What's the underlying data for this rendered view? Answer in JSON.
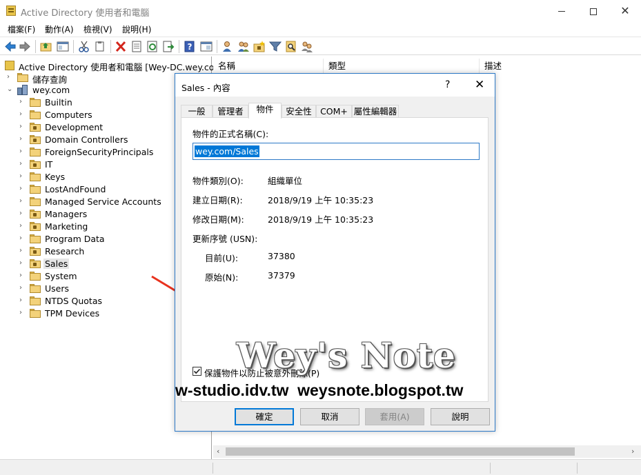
{
  "window": {
    "title": "Active Directory 使用者和電腦"
  },
  "menu": [
    "檔案(F)",
    "動作(A)",
    "檢視(V)",
    "說明(H)"
  ],
  "toolbar_icons": [
    "back-icon",
    "forward-icon",
    "up-folder-icon",
    "show-hide-tree-icon",
    "cut-icon",
    "copy-icon",
    "delete-icon",
    "properties-icon",
    "refresh-icon",
    "export-icon",
    "help-icon",
    "console-icon",
    "new-user-icon",
    "new-group-icon",
    "new-ou-icon",
    "filter-icon",
    "find-icon",
    "add-to-group-icon"
  ],
  "tree": {
    "root_label": "Active Directory 使用者和電腦 [Wey-DC.wey.com]",
    "saved_queries": "儲存查詢",
    "domain": "wey.com",
    "items": [
      {
        "label": "Builtin",
        "type": "container"
      },
      {
        "label": "Computers",
        "type": "container"
      },
      {
        "label": "Development",
        "type": "ou"
      },
      {
        "label": "Domain Controllers",
        "type": "ou"
      },
      {
        "label": "ForeignSecurityPrincipals",
        "type": "container"
      },
      {
        "label": "IT",
        "type": "ou"
      },
      {
        "label": "Keys",
        "type": "container"
      },
      {
        "label": "LostAndFound",
        "type": "container"
      },
      {
        "label": "Managed Service Accounts",
        "type": "container"
      },
      {
        "label": "Managers",
        "type": "ou"
      },
      {
        "label": "Marketing",
        "type": "ou"
      },
      {
        "label": "Program Data",
        "type": "container"
      },
      {
        "label": "Research",
        "type": "ou"
      },
      {
        "label": "Sales",
        "type": "ou"
      },
      {
        "label": "System",
        "type": "container"
      },
      {
        "label": "Users",
        "type": "container"
      },
      {
        "label": "NTDS Quotas",
        "type": "container"
      },
      {
        "label": "TPM Devices",
        "type": "container"
      }
    ],
    "selected": "Sales"
  },
  "list": {
    "columns": [
      "名稱",
      "類型",
      "描述"
    ]
  },
  "dialog": {
    "title": "Sales - 內容",
    "help": "?",
    "close": "✕",
    "tabs": [
      "一般",
      "管理者",
      "物件",
      "安全性",
      "COM+",
      "屬性編輯器"
    ],
    "active_tab": "物件",
    "canonical_name_label": "物件的正式名稱(C):",
    "canonical_name_value": "wey.com/Sales",
    "object_class_label": "物件類別(O):",
    "object_class_value": "組織單位",
    "created_label": "建立日期(R):",
    "created_value": "2018/9/19 上午 10:35:23",
    "modified_label": "修改日期(M):",
    "modified_value": "2018/9/19 上午 10:35:23",
    "usn_label": "更新序號 (USN):",
    "usn_current_label": "目前(U):",
    "usn_current_value": "37380",
    "usn_original_label": "原始(N):",
    "usn_original_value": "37379",
    "protect_label": "保護物件以防止被意外刪除(P)",
    "protect_checked": true,
    "buttons": {
      "ok": "確定",
      "cancel": "取消",
      "apply": "套用(A)",
      "help": "說明"
    }
  },
  "watermark": {
    "title": "Wey's Note",
    "urls": "w-studio.idv.tw  weysnote.blogspot.tw"
  },
  "colors": {
    "accent": "#0078d7",
    "dialog_border": "#2b78c7",
    "arrow": "#e8321e",
    "folder": "#f3d27a"
  }
}
